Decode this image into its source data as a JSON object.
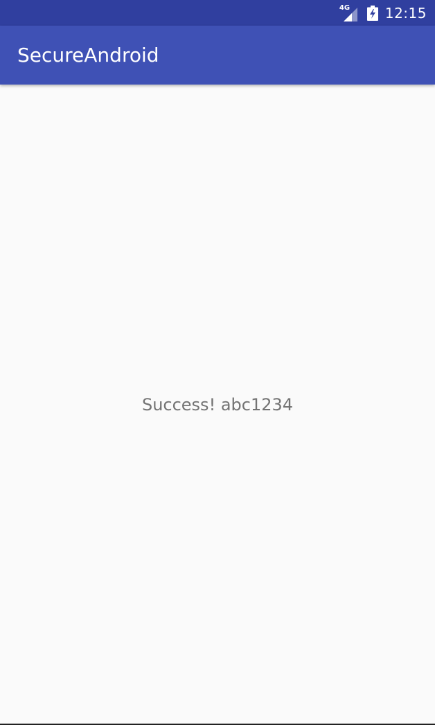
{
  "status_bar": {
    "network_label": "4G",
    "time": "12:15",
    "icons": [
      "signal-icon",
      "battery-charging-icon"
    ]
  },
  "app_bar": {
    "title": "SecureAndroid"
  },
  "main": {
    "message": "Success! abc1234"
  },
  "colors": {
    "status_bar": "#303f9f",
    "primary": "#3f51b5",
    "background": "#fafafa",
    "message_text": "#737373"
  }
}
